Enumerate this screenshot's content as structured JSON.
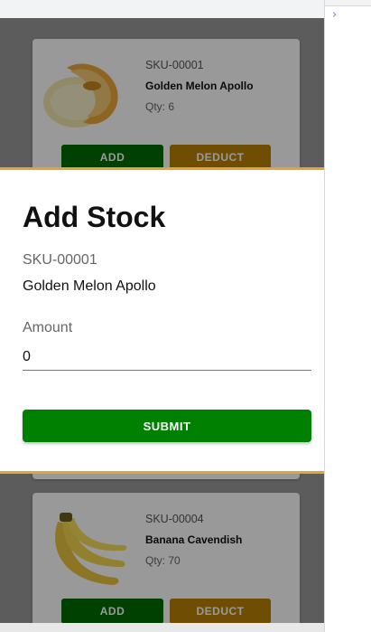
{
  "colors": {
    "add": "#006b00",
    "deduct": "#b98208",
    "submit": "#008000",
    "dialog_accent": "#e3a33b"
  },
  "devtools": {
    "expand_icon": "chevron-right-icon",
    "chevron": "›"
  },
  "products": [
    {
      "sku": "SKU-00001",
      "name": "Golden Melon Apollo",
      "qty": "Qty: 6",
      "image": "melon-image",
      "add_label": "ADD",
      "deduct_label": "DEDUCT"
    },
    {
      "sku": "SKU-00004",
      "name": "Banana Cavendish",
      "qty": "Qty: 70",
      "image": "banana-image",
      "add_label": "ADD",
      "deduct_label": "DEDUCT"
    }
  ],
  "dialog": {
    "title": "Add Stock",
    "sku": "SKU-00001",
    "name": "Golden Melon Apollo",
    "amount_label": "Amount",
    "amount_value": "0",
    "submit_label": "SUBMIT"
  }
}
